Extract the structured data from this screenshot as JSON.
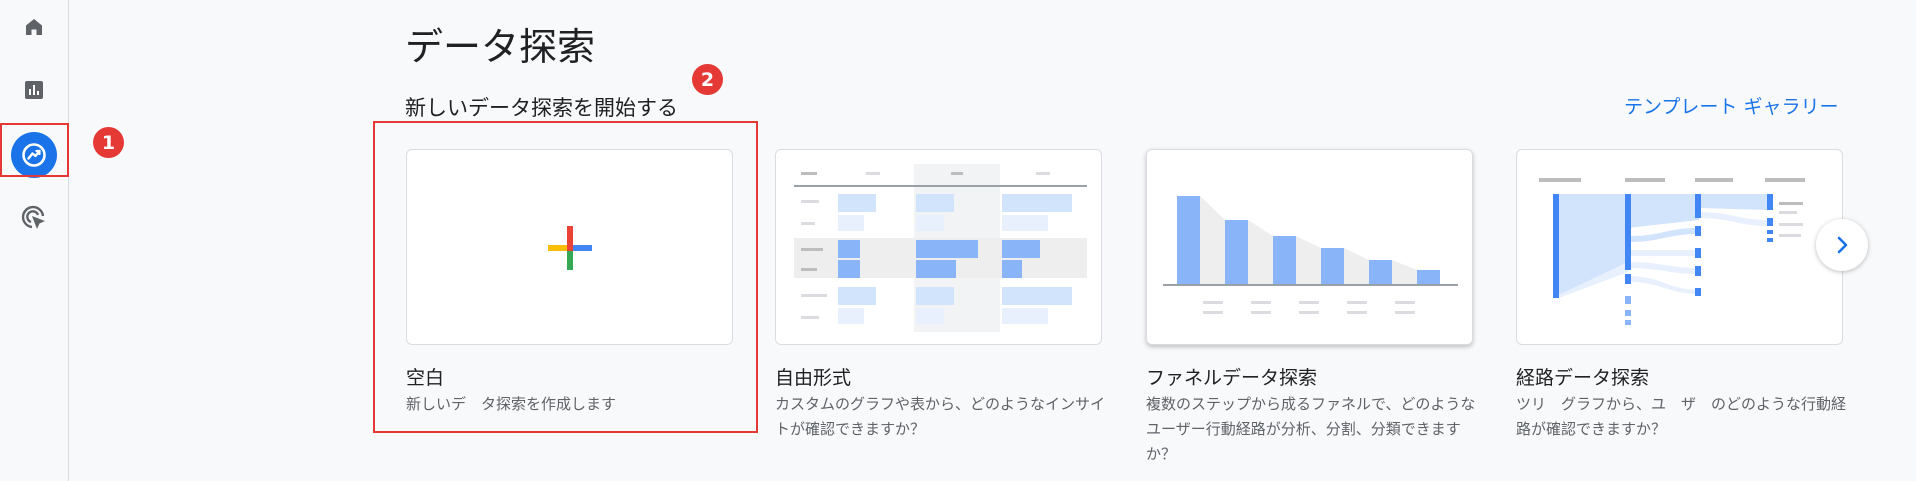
{
  "sidebar": {
    "items": [
      {
        "icon": "home-icon"
      },
      {
        "icon": "reports-icon"
      },
      {
        "icon": "explore-icon",
        "active": true
      },
      {
        "icon": "advertising-icon"
      }
    ]
  },
  "annotations": {
    "badge_1": "1",
    "badge_2": "2"
  },
  "header": {
    "title": "データ探索"
  },
  "section": {
    "title": "新しいデータ探索を開始する",
    "gallery_link": "テンプレート ギャラリー"
  },
  "cards": [
    {
      "title": "空白",
      "desc": "新しいデ　タ探索を作成します"
    },
    {
      "title": "自由形式",
      "desc": "カスタムのグラフや表から、どのようなインサイトが確認できますか？"
    },
    {
      "title": "ファネルデータ探索",
      "desc": "複数のステップから成るファネルで、どのようなユーザー行動経路が分析、分割、分類できますか？"
    },
    {
      "title": "経路データ探索",
      "desc": "ツリ　グラフから、ユ　ザ　のどのような行動経路が確認できますか？"
    }
  ],
  "colors": {
    "accent": "#1a73e8",
    "highlight": "#e53935",
    "bar_blue": "#8ab4f8",
    "bar_light": "#d2e3fc"
  }
}
